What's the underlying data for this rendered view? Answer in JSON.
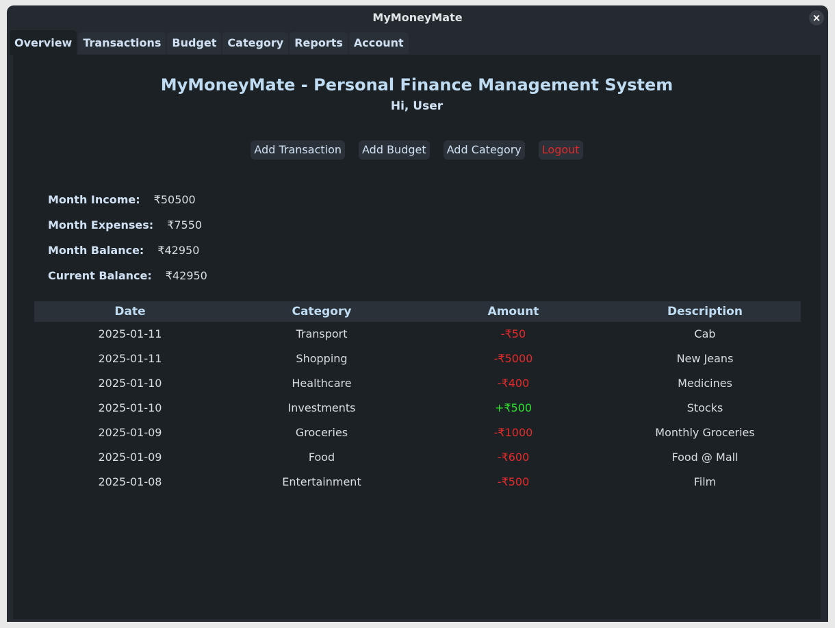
{
  "window": {
    "title": "MyMoneyMate",
    "close_label": "×"
  },
  "tabs": [
    {
      "label": "Overview",
      "active": true
    },
    {
      "label": "Transactions",
      "active": false
    },
    {
      "label": "Budget",
      "active": false
    },
    {
      "label": "Category",
      "active": false
    },
    {
      "label": "Reports",
      "active": false
    },
    {
      "label": "Account",
      "active": false
    }
  ],
  "header": {
    "title": "MyMoneyMate - Personal Finance Management System",
    "greeting": "Hi, User"
  },
  "actions": {
    "add_transaction": "Add Transaction",
    "add_budget": "Add Budget",
    "add_category": "Add Category",
    "logout": "Logout"
  },
  "summary": [
    {
      "label": "Month Income:",
      "value": "₹50500"
    },
    {
      "label": "Month Expenses:",
      "value": "₹7550"
    },
    {
      "label": "Month Balance:",
      "value": "₹42950"
    },
    {
      "label": "Current Balance:",
      "value": "₹42950"
    }
  ],
  "table": {
    "columns": [
      "Date",
      "Category",
      "Amount",
      "Description"
    ],
    "rows": [
      {
        "date": "2025-01-11",
        "category": "Transport",
        "amount": "-₹50",
        "description": "Cab",
        "type": "expense"
      },
      {
        "date": "2025-01-11",
        "category": "Shopping",
        "amount": "-₹5000",
        "description": "New Jeans",
        "type": "expense"
      },
      {
        "date": "2025-01-10",
        "category": "Healthcare",
        "amount": "-₹400",
        "description": "Medicines",
        "type": "expense"
      },
      {
        "date": "2025-01-10",
        "category": "Investments",
        "amount": "+₹500",
        "description": "Stocks",
        "type": "income"
      },
      {
        "date": "2025-01-09",
        "category": "Groceries",
        "amount": "-₹1000",
        "description": "Monthly Groceries",
        "type": "expense"
      },
      {
        "date": "2025-01-09",
        "category": "Food",
        "amount": "-₹600",
        "description": "Food @ Mall",
        "type": "expense"
      },
      {
        "date": "2025-01-08",
        "category": "Entertainment",
        "amount": "-₹500",
        "description": "Film",
        "type": "expense"
      }
    ]
  },
  "colors": {
    "expense": "#e52b2b",
    "income": "#2fe12f",
    "logout": "#e02a2a",
    "background": "#1c2126"
  }
}
